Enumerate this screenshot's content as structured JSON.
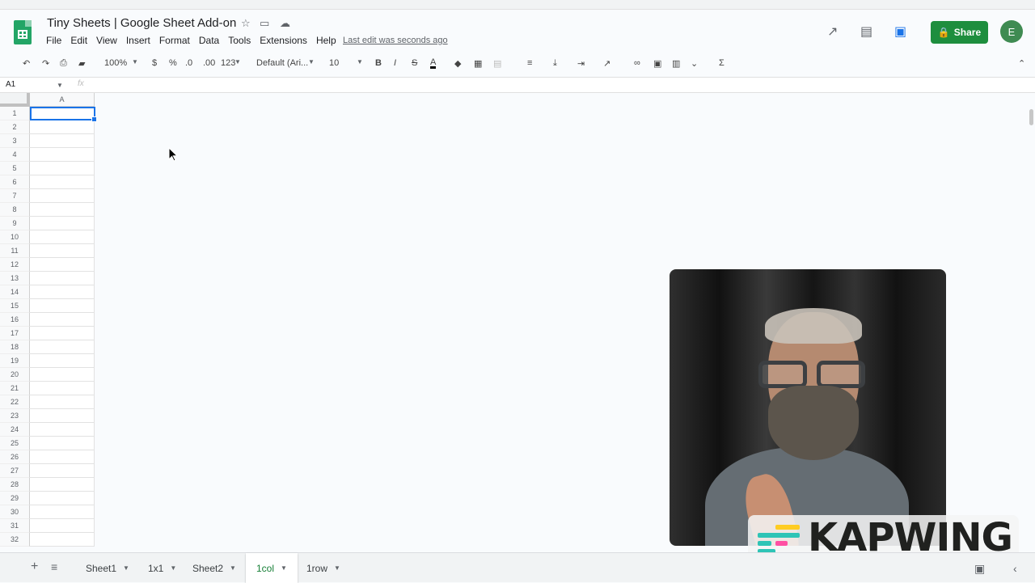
{
  "app": {
    "document_title": "Tiny Sheets | Google Sheet Add-on",
    "last_edit": "Last edit was seconds ago",
    "share_label": "Share",
    "avatar_initial": "E"
  },
  "menu": [
    "File",
    "Edit",
    "View",
    "Insert",
    "Format",
    "Data",
    "Tools",
    "Extensions",
    "Help"
  ],
  "toolbar": {
    "zoom": "100%",
    "currency": "$",
    "percent": "%",
    "decrease_decimal": ".0",
    "increase_decimal": ".00",
    "number_format": "123",
    "font_family": "Default (Ari...",
    "font_size": "10",
    "bold": "B",
    "italic": "I",
    "strike": "S",
    "text_color": "A",
    "functions": "Σ"
  },
  "formula_bar": {
    "cell_ref": "A1",
    "fx": "fx",
    "formula": ""
  },
  "sheet": {
    "column_header": "A",
    "rows": [
      "1",
      "2",
      "3",
      "4",
      "5",
      "6",
      "7",
      "8",
      "9",
      "10",
      "11",
      "12",
      "13",
      "14",
      "15",
      "16",
      "17",
      "18",
      "19",
      "20",
      "21",
      "22",
      "23",
      "24",
      "25",
      "26",
      "27",
      "28",
      "29",
      "30",
      "31",
      "32"
    ]
  },
  "tabs": [
    {
      "label": "Sheet1",
      "active": false
    },
    {
      "label": "1x1",
      "active": false
    },
    {
      "label": "Sheet2",
      "active": false
    },
    {
      "label": "1col",
      "active": true
    },
    {
      "label": "1row",
      "active": false
    }
  ],
  "watermark": {
    "text": "KAPWING",
    "colors": [
      "#ffcc23",
      "#2ec4b6",
      "#ff4fa3"
    ]
  },
  "colors": {
    "sheets_green": "#23a566",
    "share_green": "#1e8e3e",
    "selection_blue": "#1a73e8",
    "active_tab": "#188038"
  }
}
